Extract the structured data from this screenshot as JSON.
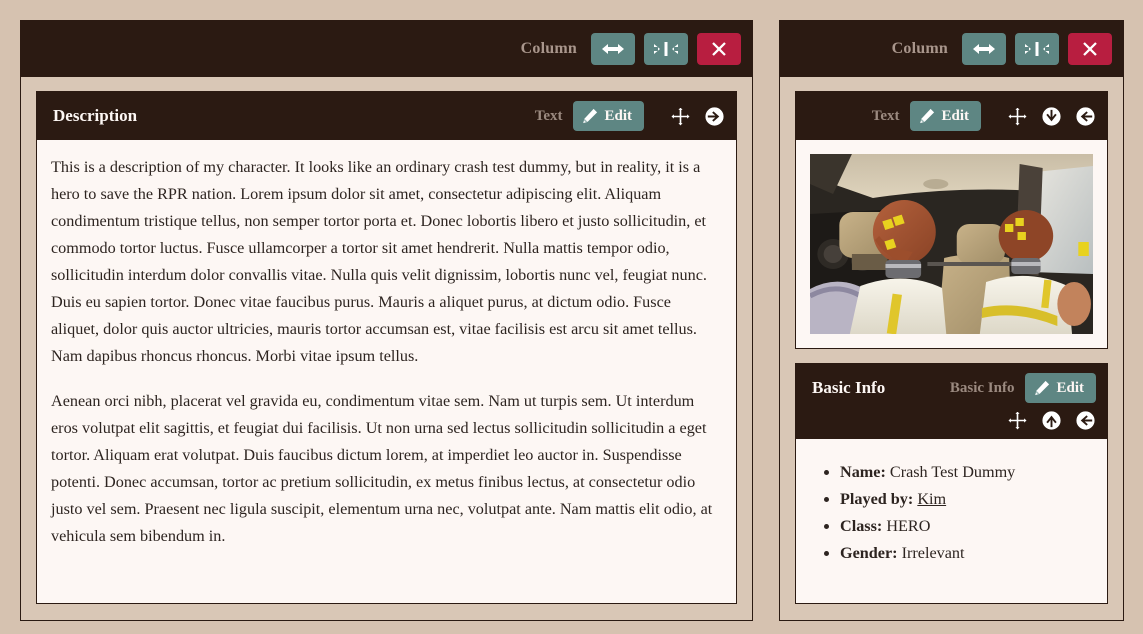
{
  "theme": {
    "page_background": "#d6c2b0",
    "column_background": "#d9c7b6",
    "dark": "#2b1a12",
    "panel_background": "#fdf7f4",
    "accent_teal": "#5e8683",
    "accent_red": "#b81e40",
    "muted_label": "#9b8a80"
  },
  "columns": [
    {
      "toolbar": {
        "label": "Column",
        "buttons": [
          {
            "name": "widen-column-button",
            "icon": "arrows-left-right-icon",
            "style": "teal"
          },
          {
            "name": "narrow-column-button",
            "icon": "arrows-to-center-icon",
            "style": "teal"
          },
          {
            "name": "close-column-button",
            "icon": "close-icon",
            "style": "red"
          }
        ]
      },
      "panels": [
        {
          "title": "Description",
          "type_label": "Text",
          "edit_label": "Edit",
          "icons": [
            {
              "name": "move-panel-icon",
              "glyph": "arrows-move-icon"
            },
            {
              "name": "move-right-icon",
              "glyph": "arrow-circle-right-icon"
            }
          ],
          "paragraphs": [
            "This is a description of my character. It looks like an ordinary crash test dummy, but in reality, it is a hero to save the RPR nation. Lorem ipsum dolor sit amet, consectetur adipiscing elit. Aliquam condimentum tristique tellus, non semper tortor porta et. Donec lobortis libero et justo sollicitudin, et commodo tortor luctus. Fusce ullamcorper a tortor sit amet hendrerit. Nulla mattis tempor odio, sollicitudin interdum dolor convallis vitae. Nulla quis velit dignissim, lobortis nunc vel, feugiat nunc. Duis eu sapien tortor. Donec vitae faucibus purus. Mauris a aliquet purus, at dictum odio. Fusce aliquet, dolor quis auctor ultricies, mauris tortor accumsan est, vitae facilisis est arcu sit amet tellus. Nam dapibus rhoncus rhoncus. Morbi vitae ipsum tellus.",
            "Aenean orci nibh, placerat vel gravida eu, condimentum vitae sem. Nam ut turpis sem. Ut interdum eros volutpat elit sagittis, et feugiat dui facilisis. Ut non urna sed lectus sollicitudin sollicitudin a eget tortor. Aliquam erat volutpat. Duis faucibus dictum lorem, at imperdiet leo auctor in. Suspendisse potenti. Donec accumsan, tortor ac pretium sollicitudin, ex metus finibus lectus, at consectetur odio justo vel sem. Praesent nec ligula suscipit, elementum urna nec, volutpat ante. Nam mattis elit odio, at vehicula sem bibendum in."
          ]
        }
      ]
    },
    {
      "toolbar": {
        "label": "Column",
        "buttons": [
          {
            "name": "widen-column-button",
            "icon": "arrows-left-right-icon",
            "style": "teal"
          },
          {
            "name": "narrow-column-button",
            "icon": "arrows-to-center-icon",
            "style": "teal"
          },
          {
            "name": "close-column-button",
            "icon": "close-icon",
            "style": "red"
          }
        ]
      },
      "panels": [
        {
          "title": "",
          "type_label": "Text",
          "edit_label": "Edit",
          "icons": [
            {
              "name": "move-panel-icon",
              "glyph": "arrows-move-icon"
            },
            {
              "name": "move-down-icon",
              "glyph": "arrow-circle-down-icon"
            },
            {
              "name": "move-left-icon",
              "glyph": "arrow-circle-left-icon"
            }
          ],
          "image_alt": "Two crash test dummies seated in a car interior"
        },
        {
          "title": "Basic Info",
          "type_label": "Basic Info",
          "edit_label": "Edit",
          "icons": [
            {
              "name": "move-panel-icon",
              "glyph": "arrows-move-icon"
            },
            {
              "name": "move-up-icon",
              "glyph": "arrow-circle-up-icon"
            },
            {
              "name": "move-left-icon",
              "glyph": "arrow-circle-left-icon"
            }
          ],
          "fields": [
            {
              "key": "Name:",
              "value": "Crash Test Dummy",
              "link": false
            },
            {
              "key": "Played by:",
              "value": "Kim",
              "link": true
            },
            {
              "key": "Class:",
              "value": "HERO",
              "link": false
            },
            {
              "key": "Gender:",
              "value": "Irrelevant",
              "link": false
            }
          ]
        }
      ]
    }
  ]
}
